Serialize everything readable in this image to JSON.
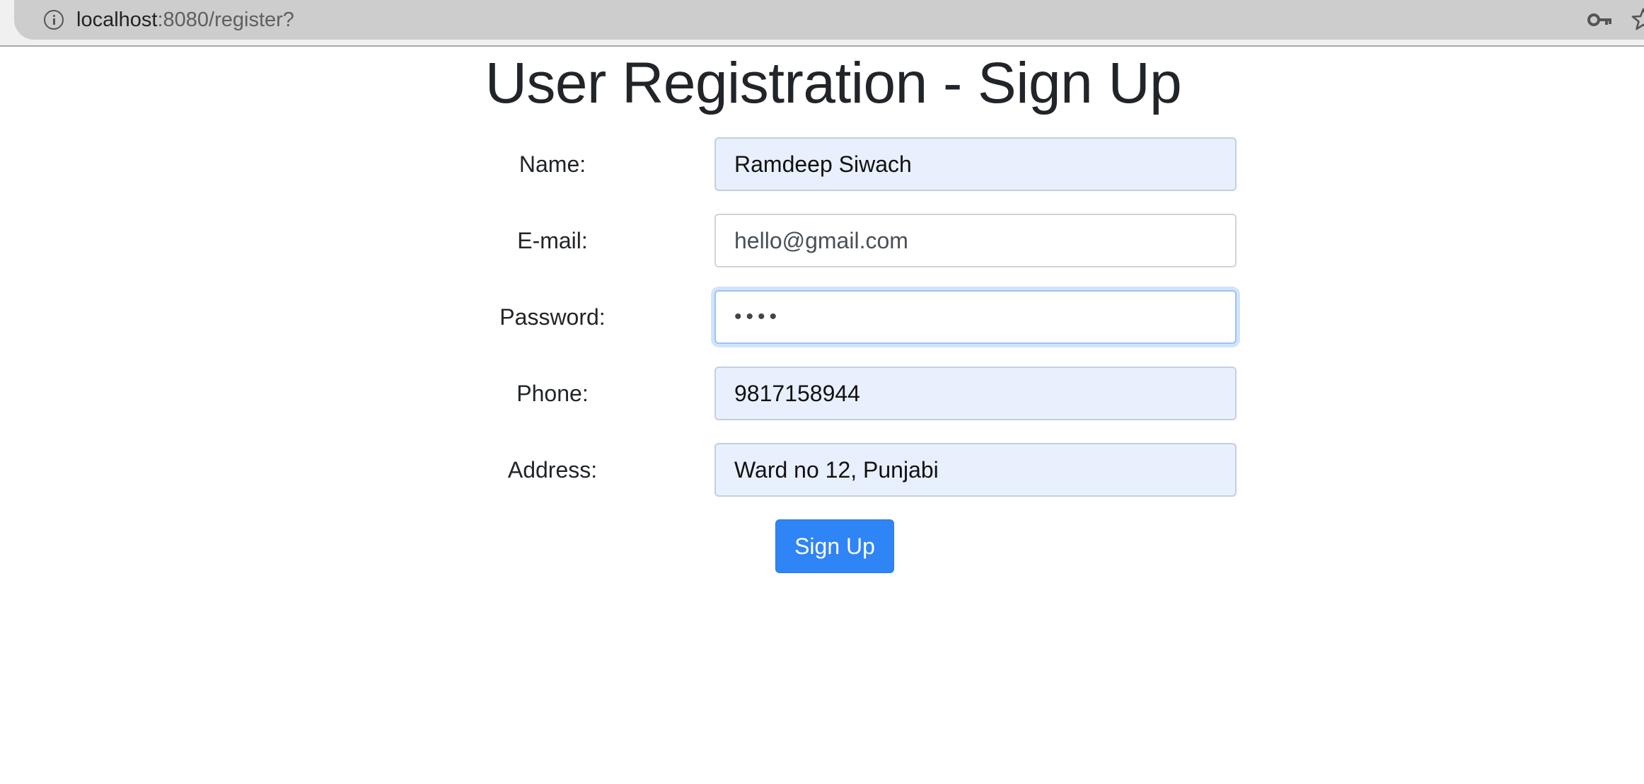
{
  "browser": {
    "url_host": "localhost",
    "url_path": ":8080/register?"
  },
  "page": {
    "title": "User Registration - Sign Up"
  },
  "form": {
    "name": {
      "label": "Name:",
      "value": "Ramdeep Siwach"
    },
    "email": {
      "label": "E-mail:",
      "value": "",
      "placeholder": "hello@gmail.com"
    },
    "password": {
      "label": "Password:",
      "value": "••••"
    },
    "phone": {
      "label": "Phone:",
      "value": "9817158944"
    },
    "address": {
      "label": "Address:",
      "value": "Ward no 12, Punjabi"
    },
    "submit_label": "Sign Up"
  },
  "colors": {
    "primary_button": "#2f84f6",
    "autofill_bg": "#e8f0fe",
    "focus_ring": "#d2e4fc"
  },
  "icons": {
    "site_info": "info-icon",
    "passwords": "key-icon",
    "bookmark": "star-icon"
  }
}
